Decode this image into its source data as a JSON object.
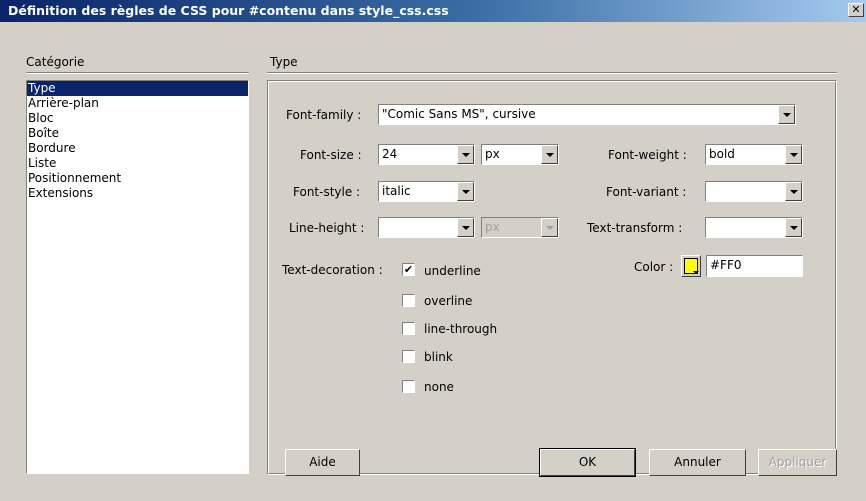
{
  "window": {
    "title": "Définition des règles de CSS pour #contenu dans style_css.css",
    "close_glyph": "✕"
  },
  "category": {
    "heading": "Catégorie",
    "items": [
      "Type",
      "Arrière-plan",
      "Bloc",
      "Boîte",
      "Bordure",
      "Liste",
      "Positionnement",
      "Extensions"
    ],
    "selected": "Type"
  },
  "section": {
    "heading": "Type"
  },
  "fields": {
    "font_family": {
      "label": "Font-family :",
      "value": "\"Comic Sans MS\", cursive"
    },
    "font_size": {
      "label": "Font-size :",
      "value": "24",
      "unit": "px"
    },
    "font_weight": {
      "label": "Font-weight :",
      "value": "bold"
    },
    "font_style": {
      "label": "Font-style :",
      "value": "italic"
    },
    "font_variant": {
      "label": "Font-variant :",
      "value": ""
    },
    "line_height": {
      "label": "Line-height :",
      "value": "",
      "unit": "px"
    },
    "text_transform": {
      "label": "Text-transform :",
      "value": ""
    },
    "color": {
      "label": "Color :",
      "value": "#FF0",
      "swatch_color": "#ffff00"
    }
  },
  "text_decoration": {
    "label": "Text-decoration :",
    "options": [
      {
        "label": "underline",
        "checked": true
      },
      {
        "label": "overline",
        "checked": false
      },
      {
        "label": "line-through",
        "checked": false
      },
      {
        "label": "blink",
        "checked": false
      },
      {
        "label": "none",
        "checked": false
      }
    ],
    "check_glyph": "✔"
  },
  "buttons": {
    "help": "Aide",
    "ok": "OK",
    "cancel": "Annuler",
    "apply": "Appliquer"
  }
}
